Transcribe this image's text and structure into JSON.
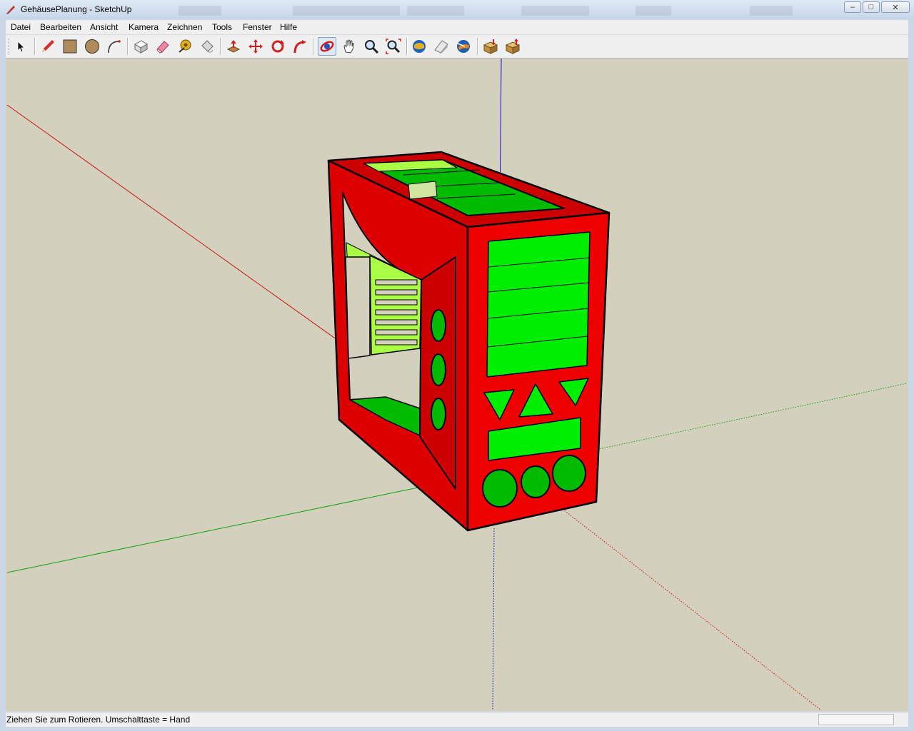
{
  "window": {
    "title": "GehäusePlanung - SketchUp",
    "controls": {
      "minimize": "–",
      "maximize": "□",
      "close": "✕"
    }
  },
  "menu": {
    "items": [
      {
        "label": "Datei"
      },
      {
        "label": "Bearbeiten"
      },
      {
        "label": "Ansicht"
      },
      {
        "label": "Kamera"
      },
      {
        "label": "Zeichnen"
      },
      {
        "label": "Tools"
      },
      {
        "label": "Fenster"
      },
      {
        "label": "Hilfe"
      }
    ]
  },
  "toolbar": {
    "tools": [
      {
        "name": "select",
        "icon": "arrow-cursor-icon"
      },
      {
        "name": "line",
        "icon": "pencil-icon"
      },
      {
        "name": "rectangle",
        "icon": "rectangle-icon"
      },
      {
        "name": "circle",
        "icon": "circle-icon"
      },
      {
        "name": "arc",
        "icon": "arc-icon"
      },
      {
        "name": "make-component",
        "icon": "component-icon"
      },
      {
        "name": "eraser",
        "icon": "eraser-icon"
      },
      {
        "name": "tape-measure",
        "icon": "tape-measure-icon"
      },
      {
        "name": "paint-bucket",
        "icon": "paint-bucket-icon"
      },
      {
        "name": "push-pull",
        "icon": "push-pull-icon"
      },
      {
        "name": "move",
        "icon": "move-icon"
      },
      {
        "name": "rotate",
        "icon": "rotate-icon"
      },
      {
        "name": "follow-me",
        "icon": "follow-me-icon"
      },
      {
        "name": "orbit",
        "icon": "orbit-icon",
        "active": true
      },
      {
        "name": "pan",
        "icon": "hand-icon"
      },
      {
        "name": "zoom",
        "icon": "magnifier-icon"
      },
      {
        "name": "zoom-extents",
        "icon": "zoom-extents-icon"
      },
      {
        "name": "get-models",
        "icon": "globe-icon"
      },
      {
        "name": "share-model",
        "icon": "share-icon"
      },
      {
        "name": "google-earth",
        "icon": "earth-icon"
      },
      {
        "name": "get-components",
        "icon": "box-down-icon"
      },
      {
        "name": "share-component",
        "icon": "box-up-icon"
      }
    ]
  },
  "viewport": {
    "background": "#d3d1bd",
    "axis_colors": {
      "red": "#d01010",
      "green": "#10a010",
      "blue": "#1010c8"
    },
    "model_colors": {
      "body": "#dd0000",
      "body_dark": "#bb0000",
      "panel": "#00ee00",
      "panel_dark": "#00bb00",
      "panel_light": "#aaff44",
      "edge": "#000000"
    }
  },
  "status": {
    "text": "Ziehen Sie zum Rotieren.  Umschalttaste = Hand"
  }
}
